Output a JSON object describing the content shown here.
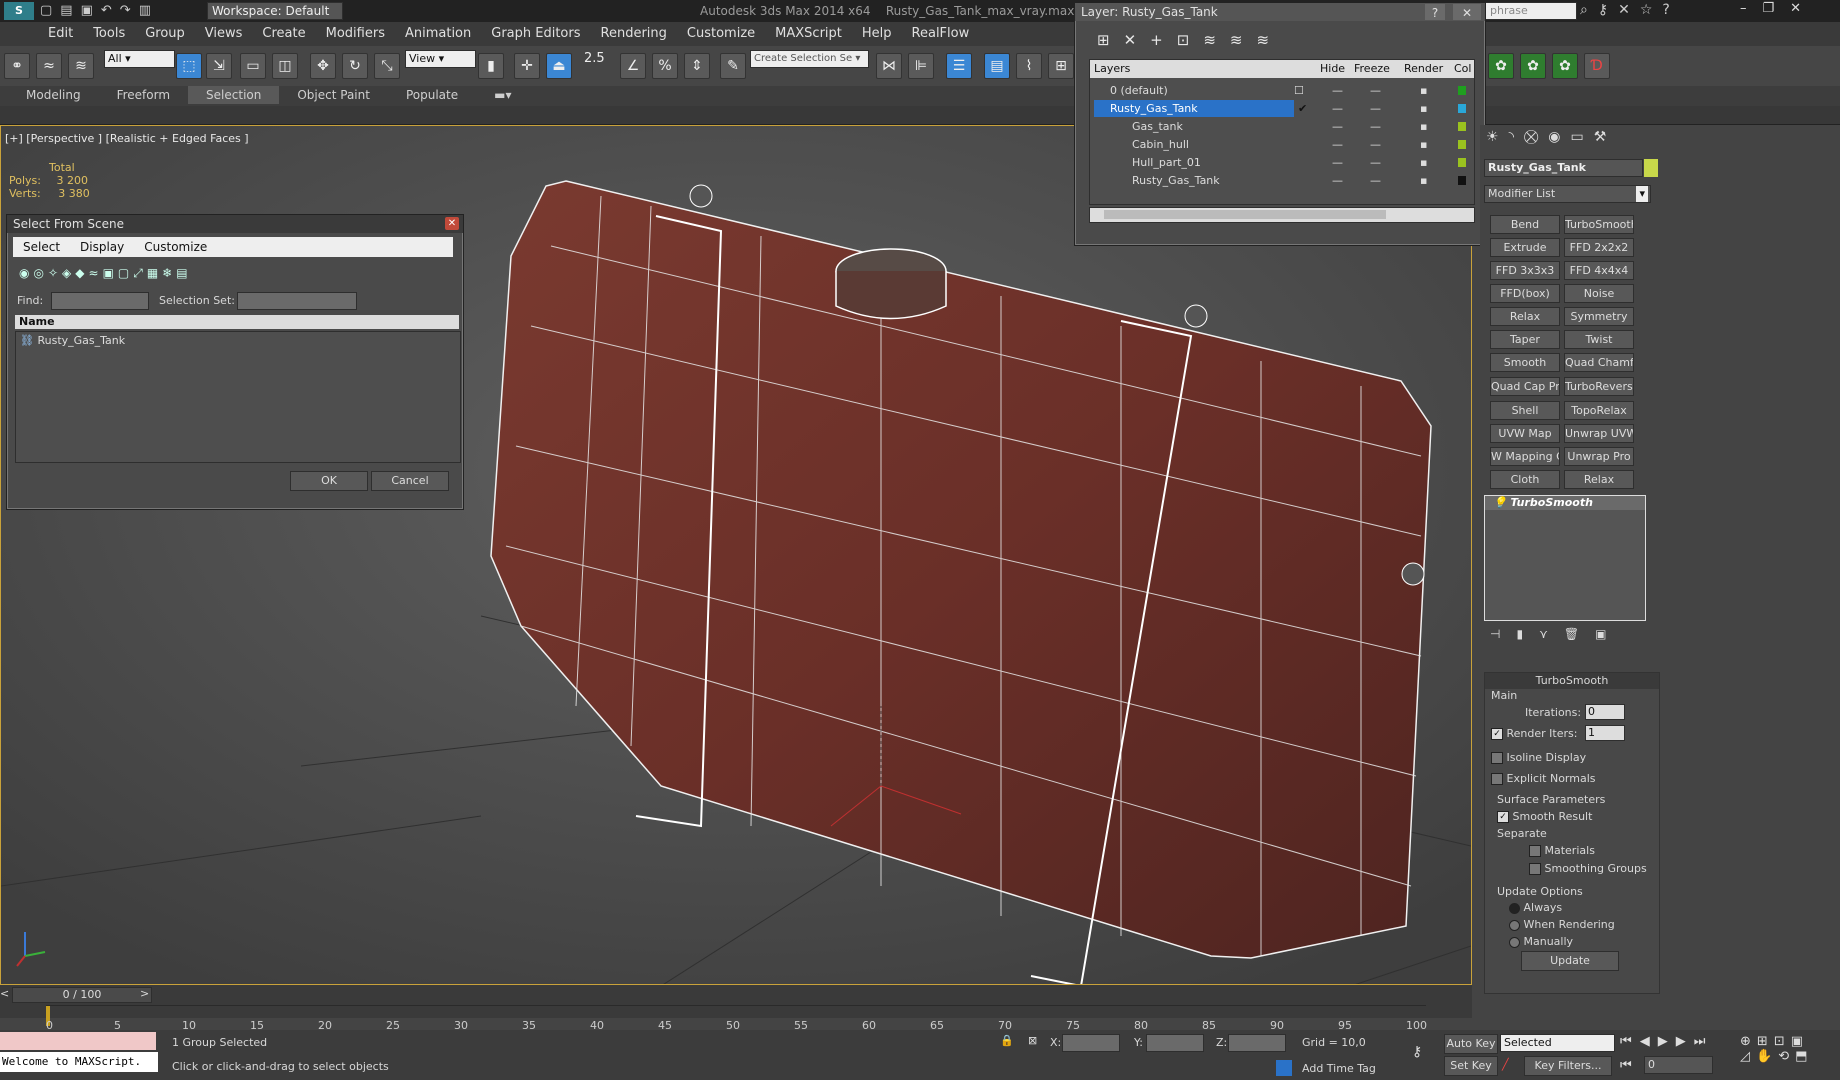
{
  "app": {
    "title": "Autodesk 3ds Max  2014 x64",
    "file": "Rusty_Gas_Tank_max_vray.max",
    "workspace": "Workspace: Default",
    "search_placeholder": "phrase"
  },
  "menu": [
    "Edit",
    "Tools",
    "Group",
    "Views",
    "Create",
    "Modifiers",
    "Animation",
    "Graph Editors",
    "Rendering",
    "Customize",
    "MAXScript",
    "Help",
    "RealFlow"
  ],
  "toolbar": {
    "filter": "All",
    "ref_coord": "View",
    "snap_value": "2.5",
    "selection_set_placeholder": "Create Selection Se"
  },
  "ribbon_tabs": [
    "Modeling",
    "Freeform",
    "Selection",
    "Object Paint",
    "Populate"
  ],
  "viewport": {
    "label": "[+] [Perspective ] [Realistic + Edged Faces ]",
    "stats_header": "Total",
    "polys_label": "Polys:",
    "polys_value": "3 200",
    "verts_label": "Verts:",
    "verts_value": "3 380"
  },
  "select_dialog": {
    "title": "Select From Scene",
    "menu": [
      "Select",
      "Display",
      "Customize"
    ],
    "find_label": "Find:",
    "selection_set_label": "Selection Set:",
    "column_name": "Name",
    "items": [
      "Rusty_Gas_Tank"
    ],
    "ok": "OK",
    "cancel": "Cancel"
  },
  "layer_dialog": {
    "title": "Layer: Rusty_Gas_Tank",
    "columns": {
      "layers": "Layers",
      "hide": "Hide",
      "freeze": "Freeze",
      "render": "Render",
      "color": "Col"
    },
    "rows": [
      {
        "name": "0 (default)",
        "indent": 0,
        "selected": false,
        "color": "#1f9f1f"
      },
      {
        "name": "Rusty_Gas_Tank",
        "indent": 0,
        "selected": true,
        "color": "#2aa7d8"
      },
      {
        "name": "Gas_tank",
        "indent": 1,
        "selected": false,
        "color": "#9ac21f"
      },
      {
        "name": "Cabin_hull",
        "indent": 1,
        "selected": false,
        "color": "#9ac21f"
      },
      {
        "name": "Hull_part_01",
        "indent": 1,
        "selected": false,
        "color": "#9ac21f"
      },
      {
        "name": "Rusty_Gas_Tank",
        "indent": 1,
        "selected": false,
        "color": "#111111"
      }
    ]
  },
  "command_panel": {
    "object_name": "Rusty_Gas_Tank",
    "object_color": "#c8d84a",
    "modifier_list": "Modifier List",
    "modifiers": [
      "Bend",
      "TurboSmooth",
      "Extrude",
      "FFD 2x2x2",
      "FFD 3x3x3",
      "FFD 4x4x4",
      "FFD(box)",
      "Noise",
      "Relax",
      "Symmetry",
      "Taper",
      "Twist",
      "Smooth",
      "Quad Chamfer",
      "Quad Cap Pro",
      "TurboReverse",
      "Shell",
      "TopoRelax",
      "UVW Map",
      "Unwrap UVW",
      "W Mapping Cle",
      "Unwrap Pro",
      "Cloth",
      "Relax"
    ],
    "stack_item": "TurboSmooth",
    "rollout_title": "TurboSmooth",
    "main_label": "Main",
    "iterations_label": "Iterations:",
    "iterations_value": "0",
    "render_iters_label": "Render Iters:",
    "render_iters_value": "1",
    "isoline_label": "Isoline Display",
    "explicit_label": "Explicit Normals",
    "surface_label": "Surface Parameters",
    "smooth_result_label": "Smooth Result",
    "separate_label": "Separate",
    "materials_label": "Materials",
    "smoothing_groups_label": "Smoothing Groups",
    "update_options_label": "Update Options",
    "always_label": "Always",
    "when_rendering_label": "When Rendering",
    "manually_label": "Manually",
    "update_button": "Update"
  },
  "timeline": {
    "frame_display": "0 / 100",
    "ticks": [
      "0",
      "5",
      "10",
      "15",
      "20",
      "25",
      "30",
      "35",
      "40",
      "45",
      "50",
      "55",
      "60",
      "65",
      "70",
      "75",
      "80",
      "85",
      "90",
      "95",
      "100"
    ]
  },
  "status": {
    "maxscript": "Welcome to MAXScript.",
    "selection": "1 Group Selected",
    "prompt": "Click or click-and-drag to select objects",
    "x_label": "X:",
    "y_label": "Y:",
    "z_label": "Z:",
    "grid": "Grid = 10,0",
    "add_time_tag": "Add Time Tag",
    "auto_key": "Auto Key",
    "set_key": "Set Key",
    "selected_dropdown": "Selected",
    "key_filters": "Key Filters...",
    "frame_value": "0"
  }
}
